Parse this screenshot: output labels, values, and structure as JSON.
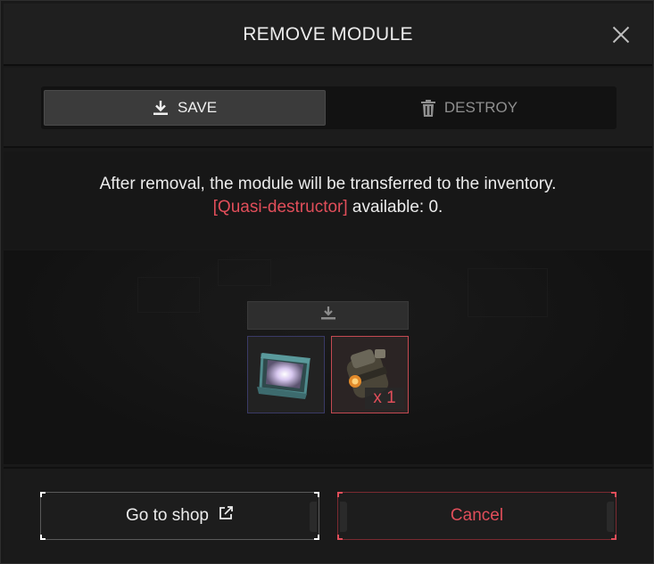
{
  "dialog": {
    "title": "REMOVE MODULE",
    "close_icon": "close-icon"
  },
  "tabs": [
    {
      "label": "SAVE",
      "icon": "download-icon",
      "selected": true
    },
    {
      "label": "DESTROY",
      "icon": "trash-icon",
      "selected": false
    }
  ],
  "message": {
    "line1": "After removal, the module will be transferred to the inventory.",
    "item_name": "[Quasi-destructor]",
    "available_text": " available: 0."
  },
  "items": {
    "save_icon": "download-icon",
    "module": {
      "icon": "module-crystal-icon"
    },
    "destructor": {
      "icon": "quasi-destructor-icon",
      "quantity": "x 1"
    }
  },
  "footer": {
    "shop_label": "Go to shop",
    "shop_icon": "external-link-icon",
    "cancel_label": "Cancel"
  },
  "colors": {
    "accent": "#e14e5a",
    "background": "#191919",
    "tab_selected": "#3b3b3b"
  }
}
